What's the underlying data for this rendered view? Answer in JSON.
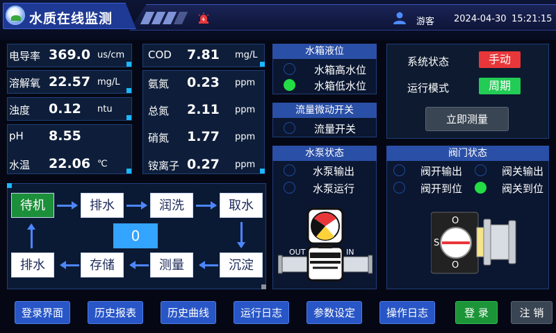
{
  "header": {
    "title": "水质在线监测",
    "user": "游客",
    "date": "2024-04-30",
    "time": "15:21:15"
  },
  "readings_left": [
    {
      "label": "电导率",
      "value": "369.0",
      "unit": "us/cm"
    },
    {
      "label": "溶解氧",
      "value": "22.57",
      "unit": "mg/L"
    },
    {
      "label": "浊度",
      "value": "0.12",
      "unit": "ntu"
    },
    {
      "label": "pH",
      "value": "8.55",
      "unit": ""
    },
    {
      "label": "水温",
      "value": "22.06",
      "unit": "℃"
    }
  ],
  "readings_right": [
    {
      "label": "COD",
      "value": "7.81",
      "unit": "mg/L"
    },
    {
      "label": "氨氮",
      "value": "0.23",
      "unit": "ppm"
    },
    {
      "label": "总氮",
      "value": "2.11",
      "unit": "ppm"
    },
    {
      "label": "硝氮",
      "value": "1.77",
      "unit": "ppm"
    },
    {
      "label": "铵离子",
      "value": "0.27",
      "unit": "ppm"
    }
  ],
  "tank_level": {
    "title": "水箱液位",
    "items": [
      {
        "label": "水箱高水位",
        "on": false
      },
      {
        "label": "水箱低水位",
        "on": true
      }
    ]
  },
  "flow_switch": {
    "title": "流量微动开关",
    "items": [
      {
        "label": "流量开关",
        "on": false
      }
    ]
  },
  "pump": {
    "title": "水泵状态",
    "items": [
      {
        "label": "水泵输出",
        "on": false
      },
      {
        "label": "水泵运行",
        "on": false
      }
    ],
    "out_label": "OUT",
    "in_label": "IN"
  },
  "valve": {
    "title": "阀门状态",
    "items": [
      {
        "label": "阀开输出",
        "on": false
      },
      {
        "label": "阀关输出",
        "on": false
      },
      {
        "label": "阀开到位",
        "on": false
      },
      {
        "label": "阀关到位",
        "on": true
      }
    ],
    "dial_top": "O",
    "dial_left": "S",
    "dial_bottom": "O"
  },
  "system": {
    "status_label": "系统状态",
    "status_value": "手动",
    "status_color": "#e8373a",
    "mode_label": "运行模式",
    "mode_value": "周期",
    "mode_color": "#22cc55",
    "measure_button": "立即测量"
  },
  "flow": {
    "steps": [
      "待机",
      "排水",
      "润洗",
      "取水",
      "沉淀",
      "测量",
      "存储",
      "排水"
    ],
    "active_index": 0,
    "counter": "0"
  },
  "footer": {
    "buttons": [
      "登录界面",
      "历史报表",
      "历史曲线",
      "运行日志",
      "参数设定",
      "操作日志"
    ],
    "login": "登 录",
    "logout": "注 销"
  },
  "colors": {
    "accent": "#2856c7",
    "active_green": "#1c8f3a",
    "indicator_on": "#22dd44"
  }
}
